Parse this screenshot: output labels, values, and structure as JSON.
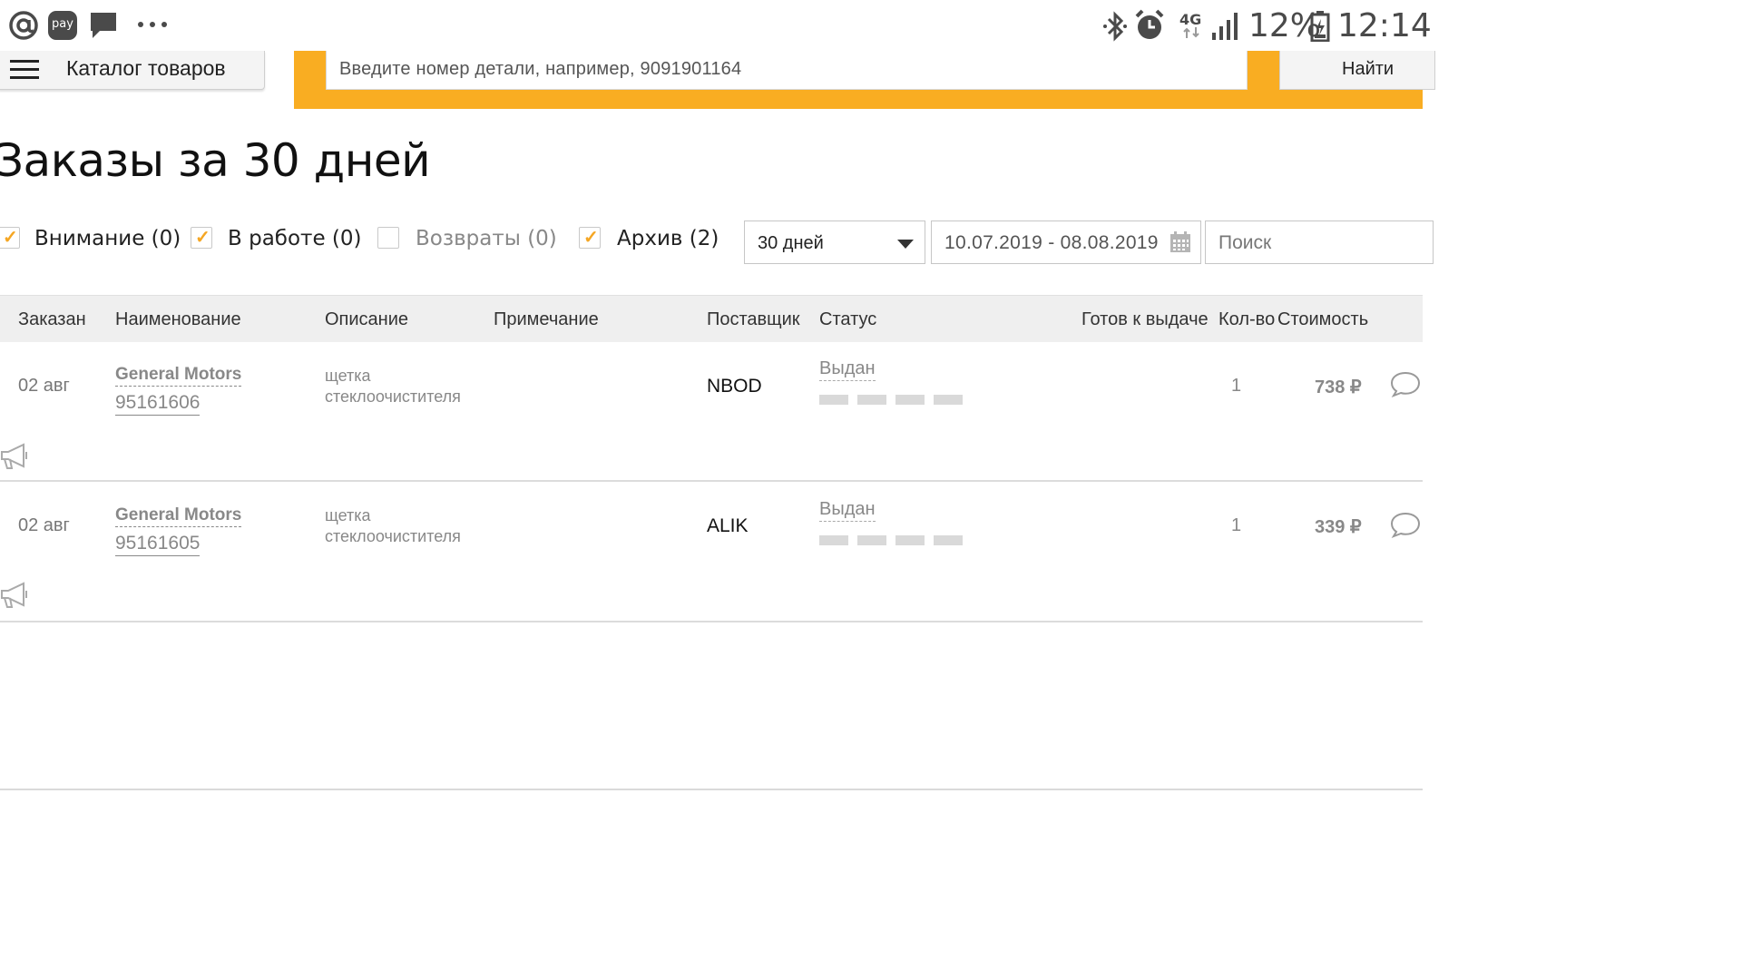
{
  "status_bar": {
    "battery": "12%",
    "time": "12:14",
    "network": "4G",
    "icons": [
      "at-icon",
      "pay-icon",
      "message-icon",
      "more-dots-icon",
      "bluetooth-icon",
      "alarm-icon",
      "signal-icon",
      "battery-icon"
    ],
    "pay_label": "pay"
  },
  "topbar": {
    "catalog_label": "Каталог товаров",
    "search_placeholder": "Введите номер детали, например, 9091901164",
    "find_label": "Найти"
  },
  "page": {
    "title": "Заказы за 30 дней"
  },
  "filters": {
    "attention": {
      "label": "Внимание (0)",
      "checked": true
    },
    "in_work": {
      "label": "В работе (0)",
      "checked": true
    },
    "returns": {
      "label": "Возвраты (0)",
      "checked": false
    },
    "archive": {
      "label": "Архив (2)",
      "checked": true
    },
    "period_value": "30 дней",
    "date_range": "10.07.2019 - 08.08.2019",
    "search_placeholder": "Поиск"
  },
  "table": {
    "columns": [
      "Заказан",
      "Наименование",
      "Описание",
      "Примечание",
      "Поставщик",
      "Статус",
      "Готов к выдаче",
      "Кол-во",
      "Стоимость"
    ],
    "rows": [
      {
        "date": "02 авг",
        "brand": "General Motors",
        "part": "95161606",
        "description_line1": "щетка",
        "description_line2": "стеклоочистителя",
        "note": "",
        "supplier": "NBOD",
        "status": "Выдан",
        "progress_steps": 4,
        "ready": "",
        "qty": "1",
        "price": "738 ₽"
      },
      {
        "date": "02 авг",
        "brand": "General Motors",
        "part": "95161605",
        "description_line1": "щетка",
        "description_line2": "стеклоочистителя",
        "note": "",
        "supplier": "ALIK",
        "status": "Выдан",
        "progress_steps": 4,
        "ready": "",
        "qty": "1",
        "price": "339 ₽"
      }
    ]
  },
  "colors": {
    "accent": "#f9ad22",
    "header_bg": "#efefef",
    "muted_text": "#888888"
  }
}
